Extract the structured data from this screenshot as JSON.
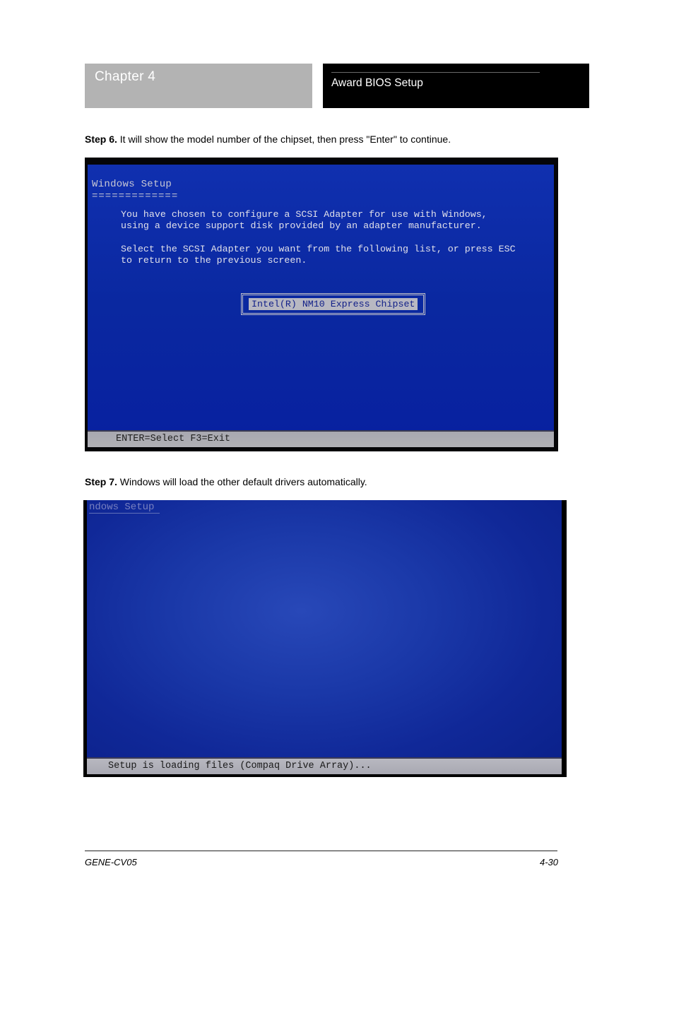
{
  "header": {
    "chapter_label": "Chapter 4",
    "chapter_title": "Award BIOS Setup"
  },
  "step6": {
    "prefix": "Step 6.",
    "text": " It will show the model number of the chipset, then press \"Enter\" to continue."
  },
  "setup1": {
    "title": "Windows Setup",
    "underline": "=============",
    "body_line1": "You have chosen to configure a SCSI Adapter for use with Windows,",
    "body_line2": "using a device support disk provided by an adapter manufacturer.",
    "body_line3": "Select the SCSI Adapter you want from the following list, or press ESC",
    "body_line4": "to return to the previous screen.",
    "selected_item": "Intel(R) NM10 Express Chipset",
    "status": "ENTER=Select  F3=Exit"
  },
  "step7": {
    "prefix": "Step 7.",
    "text": " Windows will load the other default drivers automatically."
  },
  "setup2": {
    "title_fragment": "ndows Setup",
    "status": "Setup is loading files (Compaq Drive Array)..."
  },
  "footer": {
    "left": "GENE-CV05",
    "right": "4-30"
  }
}
